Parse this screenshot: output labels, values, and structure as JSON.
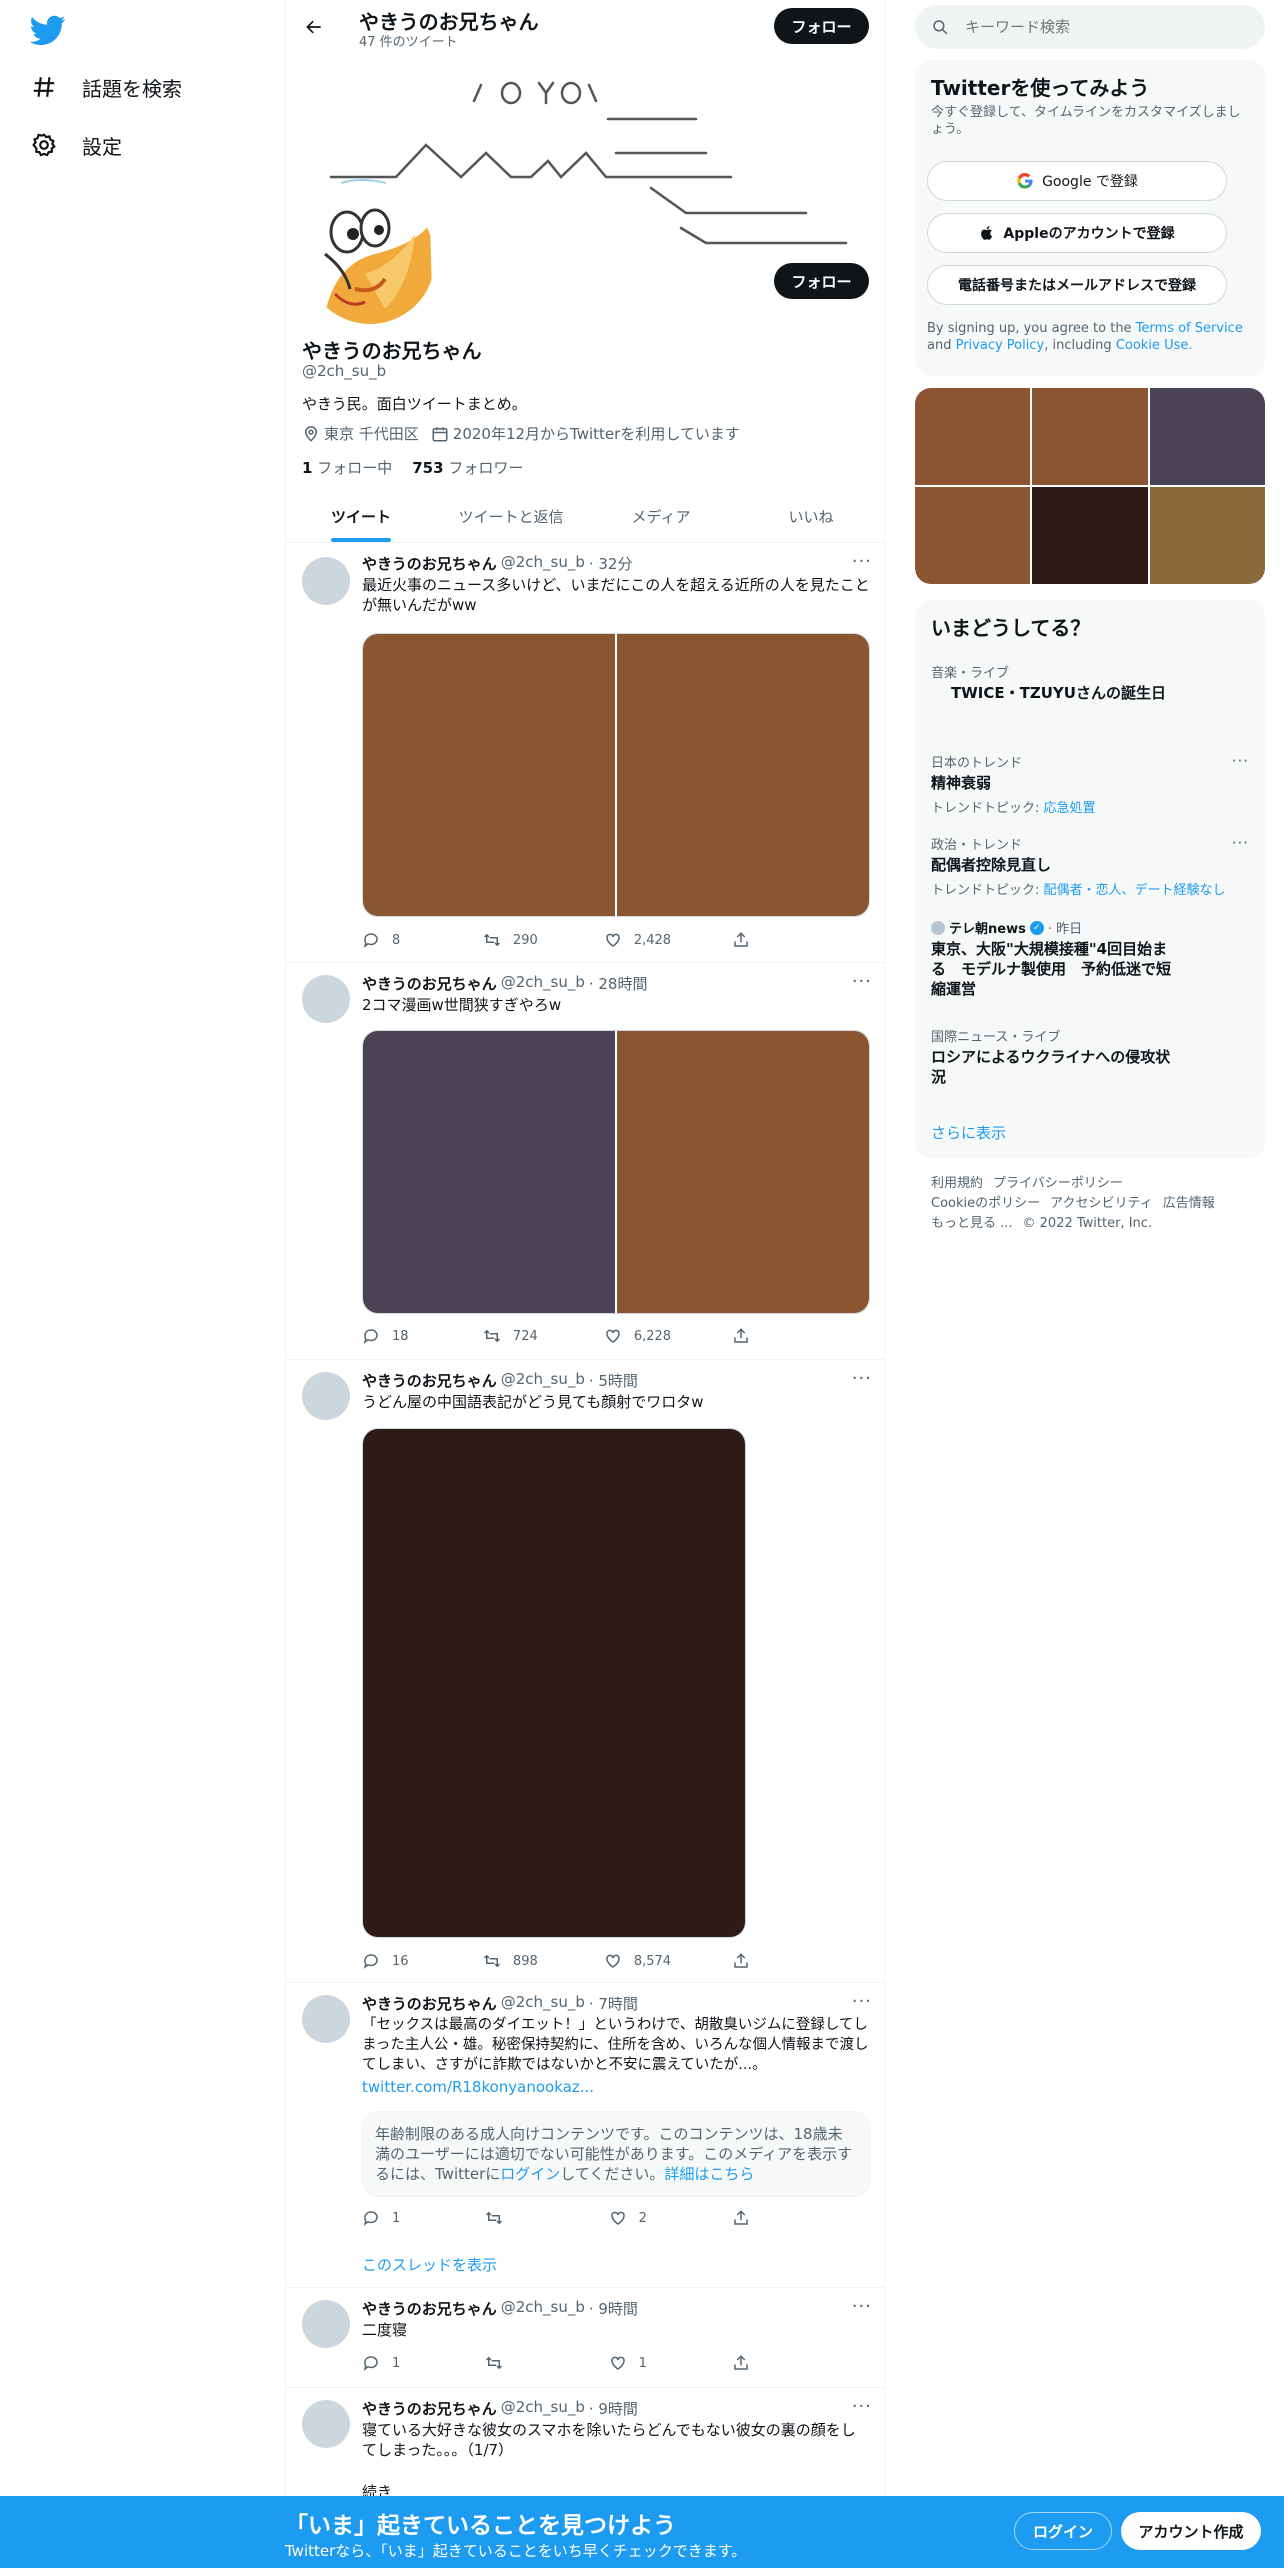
{
  "nav": {
    "explore": "話題を検索",
    "settings": "設定"
  },
  "header": {
    "title": "やきうのお兄ちゃん",
    "tweet_count": "47 件のツイート",
    "follow": "フォロー"
  },
  "profile": {
    "name": "やきうのお兄ちゃん",
    "handle": "@2ch_su_b",
    "bio": "やきう民。面白ツイートまとめ。",
    "location": "東京 千代田区",
    "joined": "2020年12月からTwitterを利用しています",
    "following_count": "1",
    "following_label": "フォロー中",
    "followers_count": "753",
    "followers_label": "フォロワー",
    "follow": "フォロー",
    "banner_ascii": [
      " /O YO\\  ",
      "　　　　＿＿＿",
      "＿＿＿/　＼＿/＼＿ノ　ヽ＿＿＿＿",
      "　　　　　　　　　＼＿＿＿＿",
      "　　　　　　　　　　＼＿＿＿＿＿"
    ]
  },
  "tabs": [
    "ツイート",
    "ツイートと返信",
    "メディア",
    "いいね"
  ],
  "tweets": [
    {
      "name": "やきうのお兄ちゃん",
      "handle": "@2ch_su_b",
      "time": "· 32分",
      "text": "最近火事のニュース多いけど、いまだにこの人を超える近所の人を見たことが無いんだがww",
      "replies": "8",
      "retweets": "290",
      "likes": "2,428"
    },
    {
      "name": "やきうのお兄ちゃん",
      "handle": "@2ch_su_b",
      "time": "· 28時間",
      "text": "2コマ漫画w世間狭すぎやろw",
      "replies": "18",
      "retweets": "724",
      "likes": "6,228"
    },
    {
      "name": "やきうのお兄ちゃん",
      "handle": "@2ch_su_b",
      "time": "· 5時間",
      "text": "うどん屋の中国語表記がどう見ても顔射でワロタw",
      "replies": "16",
      "retweets": "898",
      "likes": "8,574"
    },
    {
      "name": "やきうのお兄ちゃん",
      "handle": "@2ch_su_b",
      "time": "· 7時間",
      "text": "「セックスは最高のダイエット！」というわけで、胡散臭いジムに登録してしまった主人公・雄。秘密保持契約に、住所を含め、いろんな個人情報まで渡してしまい、さすがに詐欺ではないかと不安に震えていたが...。",
      "link": "twitter.com/R18konyanookaz...",
      "sensitive_text": "年齢制限のある成人向けコンテンツです。このコンテンツは、18歳未満のユーザーには適切でない可能性があります。このメディアを表示するには、Twitterに",
      "sensitive_login": "ログイン",
      "sensitive_mid": "してください。",
      "sensitive_more": "詳細はこちら",
      "replies": "1",
      "retweets": "",
      "likes": "2",
      "thread": "このスレッドを表示"
    },
    {
      "name": "やきうのお兄ちゃん",
      "handle": "@2ch_su_b",
      "time": "· 9時間",
      "text": "二度寝",
      "replies": "1",
      "retweets": "",
      "likes": "1"
    },
    {
      "name": "やきうのお兄ちゃん",
      "handle": "@2ch_su_b",
      "time": "· 9時間",
      "text": "寝ている大好きな彼女のスマホを除いたらどんでもない彼女の裏の顔をしてしまった。。。（1/7）",
      "text2": "続き"
    }
  ],
  "search": {
    "placeholder": "キーワード検索"
  },
  "signup": {
    "title": "Twitterを使ってみよう",
    "subtitle": "今すぐ登録して、タイムラインをカスタマイズしましょう。",
    "google": "Google で登録",
    "apple": "Appleのアカウントで登録",
    "phone": "電話番号またはメールアドレスで登録",
    "legal_pre": "By signing up, you agree to the ",
    "tos": "Terms of Service",
    "legal_and": " and ",
    "privacy": "Privacy Policy",
    "legal_incl": ", including ",
    "cookie": "Cookie Use."
  },
  "trends": {
    "title": "いまどうしてる？",
    "items": [
      {
        "context": "音楽・ライブ",
        "title": "TWICE・TZUYUさんの誕生日"
      },
      {
        "context": "日本のトレンド",
        "title": "精神衰弱",
        "topic_label": "トレンドトピック: ",
        "topic": "応急処置"
      },
      {
        "context": "政治・トレンド",
        "title": "配偶者控除見直し",
        "topic_label": "トレンドトピック: ",
        "topic": "配偶者・恋人、デート経験なし"
      },
      {
        "source": "テレ朝news",
        "time": "· 昨日",
        "title": "東京、大阪\"大規模接種\"4回目始まる　モデルナ製使用　予約低迷で短縮運営"
      },
      {
        "context": "国際ニュース・ライブ",
        "title": "ロシアによるウクライナへの侵攻状況"
      }
    ],
    "more": "さらに表示"
  },
  "footer": {
    "line1": [
      "利用規約",
      "プライバシーポリシー"
    ],
    "line2": [
      "Cookieのポリシー",
      "アクセシビリティ",
      "広告情報"
    ],
    "line3": [
      "もっと見る ...",
      "© 2022 Twitter, Inc."
    ]
  },
  "bottombar": {
    "title": "「いま」起きていることを見つけよう",
    "subtitle": "Twitterなら、「いま」起きていることをいち早くチェックできます。",
    "login": "ログイン",
    "signup": "アカウント作成"
  },
  "colors": {
    "accent": "#1d9bf0",
    "media_brown": "#8a5530",
    "media_purple": "#4a4356",
    "media_dark": "#2e1a16",
    "media_olive": "#8a6a3c"
  }
}
